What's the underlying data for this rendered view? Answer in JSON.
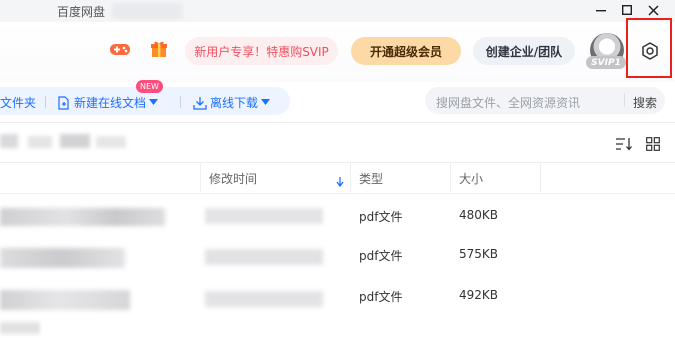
{
  "window": {
    "title": "百度网盘",
    "controls": [
      "minimize-icon",
      "maximize-icon",
      "close-icon"
    ]
  },
  "header": {
    "game_icon": "gamepad-icon",
    "gift_icon": "gift-icon",
    "promo_label": "新用户专享！特惠购SVIP",
    "vip_button": "开通超级会员",
    "enterprise_button": "创建企业/团队",
    "avatar_badge": "SVIP1",
    "settings_icon": "gear-icon",
    "colors": {
      "promo_text": "#f0505f",
      "vip_bg": "#fcd9a5",
      "highlight_box": "#e8201e"
    }
  },
  "toolbar": {
    "folder_partial": "文件夹",
    "new_online_doc": "新建在线文档",
    "new_badge": "NEW",
    "offline_download": "离线下载",
    "search_placeholder": "搜网盘文件、全网资源资讯",
    "search_button": "搜索",
    "accent": "#1e6fff"
  },
  "view": {
    "sort_icon": "sort-icon",
    "grid_icon": "grid-icon"
  },
  "table": {
    "columns": [
      {
        "label": "修改时间",
        "sorted_desc": true
      },
      {
        "label": "类型"
      },
      {
        "label": "大小"
      }
    ],
    "rows": [
      {
        "type": "pdf文件",
        "size": "480KB"
      },
      {
        "type": "pdf文件",
        "size": "575KB"
      },
      {
        "type": "pdf文件",
        "size": "492KB"
      }
    ]
  }
}
